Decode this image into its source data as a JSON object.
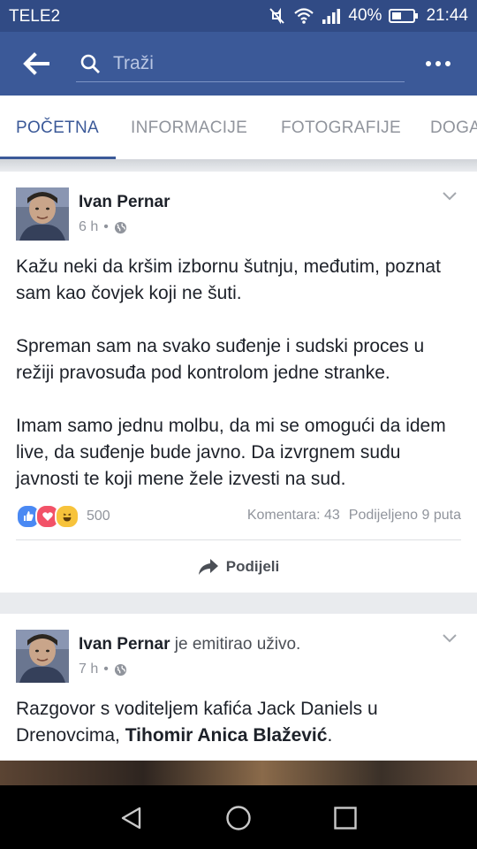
{
  "status": {
    "carrier": "TELE2",
    "battery": "40%",
    "time": "21:44"
  },
  "search": {
    "placeholder": "Traži"
  },
  "tabs": [
    {
      "label": "POČETNA",
      "active": true
    },
    {
      "label": "INFORMACIJE"
    },
    {
      "label": "FOTOGRAFIJE"
    },
    {
      "label": "DOGA"
    }
  ],
  "posts": [
    {
      "author": "Ivan Pernar",
      "action": "",
      "time": "6 h",
      "paragraphs": [
        "Kažu neki da kršim izbornu šutnju, međutim, poznat sam kao čovjek koji ne šuti.",
        "Spreman sam na svako suđenje i sudski proces u režiji pravosuđa pod kontrolom jedne stranke.",
        "Imam samo jednu molbu, da mi se omogući da idem live, da suđenje bude javno. Da izvrgnem sudu javnosti te koji mene žele izvesti na sud."
      ],
      "reaction_count": "500",
      "comments": "Komentara: 43",
      "shares": "Podijeljeno 9 puta",
      "share_label": "Podijeli"
    },
    {
      "author": "Ivan Pernar",
      "action": "je emitirao uživo.",
      "time": "7 h",
      "text_plain": "Razgovor s voditeljem kafića Jack Daniels u Drenovcima, ",
      "text_bold": "Tihomir Anica Blažević",
      "text_end": "."
    }
  ],
  "colors": {
    "brand": "#3b5998",
    "statusbar": "#314b85",
    "like": "#4a89f3",
    "love": "#f25268",
    "haha": "#f7c33b"
  },
  "icons": [
    "mute-icon",
    "wifi-icon",
    "signal-icon",
    "battery-icon",
    "back-arrow-icon",
    "search-icon",
    "more-icon",
    "chevron-down-icon",
    "globe-icon",
    "like-reaction-icon",
    "love-reaction-icon",
    "haha-reaction-icon",
    "share-icon",
    "nav-back-icon",
    "nav-home-icon",
    "nav-recents-icon"
  ]
}
